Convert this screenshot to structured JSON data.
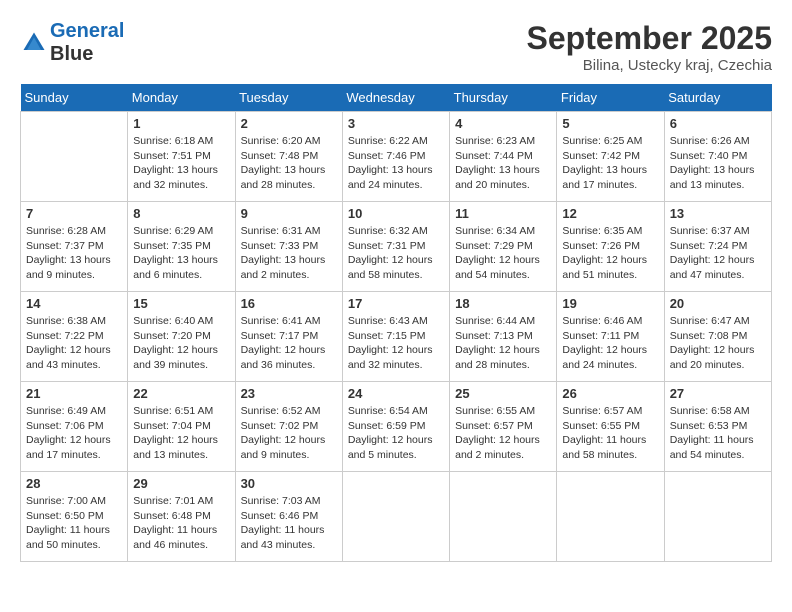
{
  "header": {
    "logo_line1": "General",
    "logo_line2": "Blue",
    "month": "September 2025",
    "location": "Bilina, Ustecky kraj, Czechia"
  },
  "days_of_week": [
    "Sunday",
    "Monday",
    "Tuesday",
    "Wednesday",
    "Thursday",
    "Friday",
    "Saturday"
  ],
  "weeks": [
    [
      {
        "day": "",
        "info": ""
      },
      {
        "day": "1",
        "info": "Sunrise: 6:18 AM\nSunset: 7:51 PM\nDaylight: 13 hours\nand 32 minutes."
      },
      {
        "day": "2",
        "info": "Sunrise: 6:20 AM\nSunset: 7:48 PM\nDaylight: 13 hours\nand 28 minutes."
      },
      {
        "day": "3",
        "info": "Sunrise: 6:22 AM\nSunset: 7:46 PM\nDaylight: 13 hours\nand 24 minutes."
      },
      {
        "day": "4",
        "info": "Sunrise: 6:23 AM\nSunset: 7:44 PM\nDaylight: 13 hours\nand 20 minutes."
      },
      {
        "day": "5",
        "info": "Sunrise: 6:25 AM\nSunset: 7:42 PM\nDaylight: 13 hours\nand 17 minutes."
      },
      {
        "day": "6",
        "info": "Sunrise: 6:26 AM\nSunset: 7:40 PM\nDaylight: 13 hours\nand 13 minutes."
      }
    ],
    [
      {
        "day": "7",
        "info": "Sunrise: 6:28 AM\nSunset: 7:37 PM\nDaylight: 13 hours\nand 9 minutes."
      },
      {
        "day": "8",
        "info": "Sunrise: 6:29 AM\nSunset: 7:35 PM\nDaylight: 13 hours\nand 6 minutes."
      },
      {
        "day": "9",
        "info": "Sunrise: 6:31 AM\nSunset: 7:33 PM\nDaylight: 13 hours\nand 2 minutes."
      },
      {
        "day": "10",
        "info": "Sunrise: 6:32 AM\nSunset: 7:31 PM\nDaylight: 12 hours\nand 58 minutes."
      },
      {
        "day": "11",
        "info": "Sunrise: 6:34 AM\nSunset: 7:29 PM\nDaylight: 12 hours\nand 54 minutes."
      },
      {
        "day": "12",
        "info": "Sunrise: 6:35 AM\nSunset: 7:26 PM\nDaylight: 12 hours\nand 51 minutes."
      },
      {
        "day": "13",
        "info": "Sunrise: 6:37 AM\nSunset: 7:24 PM\nDaylight: 12 hours\nand 47 minutes."
      }
    ],
    [
      {
        "day": "14",
        "info": "Sunrise: 6:38 AM\nSunset: 7:22 PM\nDaylight: 12 hours\nand 43 minutes."
      },
      {
        "day": "15",
        "info": "Sunrise: 6:40 AM\nSunset: 7:20 PM\nDaylight: 12 hours\nand 39 minutes."
      },
      {
        "day": "16",
        "info": "Sunrise: 6:41 AM\nSunset: 7:17 PM\nDaylight: 12 hours\nand 36 minutes."
      },
      {
        "day": "17",
        "info": "Sunrise: 6:43 AM\nSunset: 7:15 PM\nDaylight: 12 hours\nand 32 minutes."
      },
      {
        "day": "18",
        "info": "Sunrise: 6:44 AM\nSunset: 7:13 PM\nDaylight: 12 hours\nand 28 minutes."
      },
      {
        "day": "19",
        "info": "Sunrise: 6:46 AM\nSunset: 7:11 PM\nDaylight: 12 hours\nand 24 minutes."
      },
      {
        "day": "20",
        "info": "Sunrise: 6:47 AM\nSunset: 7:08 PM\nDaylight: 12 hours\nand 20 minutes."
      }
    ],
    [
      {
        "day": "21",
        "info": "Sunrise: 6:49 AM\nSunset: 7:06 PM\nDaylight: 12 hours\nand 17 minutes."
      },
      {
        "day": "22",
        "info": "Sunrise: 6:51 AM\nSunset: 7:04 PM\nDaylight: 12 hours\nand 13 minutes."
      },
      {
        "day": "23",
        "info": "Sunrise: 6:52 AM\nSunset: 7:02 PM\nDaylight: 12 hours\nand 9 minutes."
      },
      {
        "day": "24",
        "info": "Sunrise: 6:54 AM\nSunset: 6:59 PM\nDaylight: 12 hours\nand 5 minutes."
      },
      {
        "day": "25",
        "info": "Sunrise: 6:55 AM\nSunset: 6:57 PM\nDaylight: 12 hours\nand 2 minutes."
      },
      {
        "day": "26",
        "info": "Sunrise: 6:57 AM\nSunset: 6:55 PM\nDaylight: 11 hours\nand 58 minutes."
      },
      {
        "day": "27",
        "info": "Sunrise: 6:58 AM\nSunset: 6:53 PM\nDaylight: 11 hours\nand 54 minutes."
      }
    ],
    [
      {
        "day": "28",
        "info": "Sunrise: 7:00 AM\nSunset: 6:50 PM\nDaylight: 11 hours\nand 50 minutes."
      },
      {
        "day": "29",
        "info": "Sunrise: 7:01 AM\nSunset: 6:48 PM\nDaylight: 11 hours\nand 46 minutes."
      },
      {
        "day": "30",
        "info": "Sunrise: 7:03 AM\nSunset: 6:46 PM\nDaylight: 11 hours\nand 43 minutes."
      },
      {
        "day": "",
        "info": ""
      },
      {
        "day": "",
        "info": ""
      },
      {
        "day": "",
        "info": ""
      },
      {
        "day": "",
        "info": ""
      }
    ]
  ]
}
